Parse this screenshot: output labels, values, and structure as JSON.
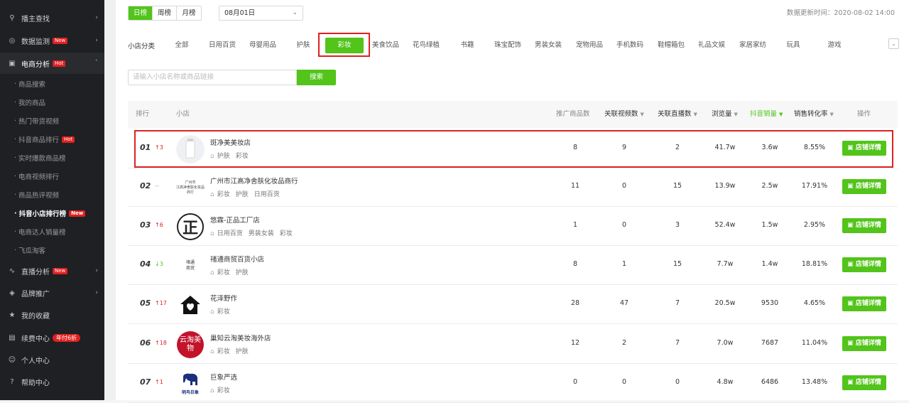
{
  "sidebar": {
    "items": [
      {
        "icon": "search-icon",
        "glyph": "⚲",
        "label": "播主查找",
        "arrow": "›"
      },
      {
        "icon": "monitor-icon",
        "glyph": "◎",
        "label": "数据监测",
        "badge": "New",
        "arrow": "›"
      },
      {
        "icon": "shop-icon",
        "glyph": "▣",
        "label": "电商分析",
        "badge": "Hot",
        "arrow": "ˆ"
      },
      {
        "icon": "live-icon",
        "glyph": "∿",
        "label": "直播分析",
        "badge": "New",
        "arrow": "›"
      },
      {
        "icon": "brand-icon",
        "glyph": "◈",
        "label": "品牌推广",
        "arrow": "›"
      },
      {
        "icon": "star-icon",
        "glyph": "★",
        "label": "我的收藏"
      },
      {
        "icon": "renew-icon",
        "glyph": "▤",
        "label": "续费中心",
        "badge": "年付6折"
      },
      {
        "icon": "user-icon",
        "glyph": "☺",
        "label": "个人中心"
      },
      {
        "icon": "help-icon",
        "glyph": "?",
        "label": "帮助中心"
      }
    ],
    "sub_items": [
      {
        "label": "商品搜索"
      },
      {
        "label": "我的商品"
      },
      {
        "label": "热门带货视频"
      },
      {
        "label": "抖音商品排行",
        "badge": "Hot"
      },
      {
        "label": "实时爆款商品榜"
      },
      {
        "label": "电商视频排行"
      },
      {
        "label": "商品热评视频"
      },
      {
        "label": "抖音小店排行榜",
        "badge": "New"
      },
      {
        "label": "电商达人销量榜"
      },
      {
        "label": "飞瓜淘客"
      }
    ]
  },
  "period_tabs": [
    "日榜",
    "周榜",
    "月榜"
  ],
  "date": {
    "value": "08月01日",
    "chevron": "⌄"
  },
  "updated": "数据更新时间：2020-08-02 14:00",
  "category": {
    "label": "小店分类",
    "items": [
      "全部",
      "日用百货",
      "母婴用品",
      "护肤",
      "彩妆",
      "美食饮品",
      "花鸟绿植",
      "书籍",
      "珠宝配饰",
      "男装女装",
      "宠物用品",
      "手机数码",
      "鞋帽箱包",
      "礼品文娱",
      "家居家纺",
      "玩具",
      "游戏"
    ],
    "more": "⌄"
  },
  "search": {
    "placeholder": "请输入小店名称或商品链接",
    "button": "搜索"
  },
  "table": {
    "headers": {
      "rank": "排行",
      "shop": "小店",
      "products": "推广商品数",
      "videos": "关联视频数",
      "lives": "关联直播数",
      "views": "浏览量",
      "sales": "抖音销量",
      "conv": "销售转化率",
      "action": "操作"
    },
    "tri": "▼",
    "tag_icon": "⌂",
    "detail_label": "店铺详情",
    "detail_icon": "▣",
    "rows": [
      {
        "rank": "01",
        "chg": "↑3",
        "dir": "up",
        "name": "斑净美美妆店",
        "tags": [
          "护肤",
          "彩妆"
        ],
        "products": "8",
        "videos": "9",
        "lives": "2",
        "views": "41.7w",
        "sales": "3.6w",
        "conv": "8.55%"
      },
      {
        "rank": "02",
        "chg": "--",
        "dir": "flat",
        "name": "广州市江高净舍肤化妆品商行",
        "logo_l1": "广州市",
        "logo_l2": "江高净舍肤化妆品商行",
        "tags": [
          "彩妆",
          "护肤",
          "日用百货"
        ],
        "products": "11",
        "videos": "0",
        "lives": "15",
        "views": "13.9w",
        "sales": "2.5w",
        "conv": "17.91%"
      },
      {
        "rank": "03",
        "chg": "↑6",
        "dir": "up",
        "name": "悠霖-正品工厂店",
        "logo_text": "正",
        "tags": [
          "日用百货",
          "男装女装",
          "彩妆"
        ],
        "products": "1",
        "videos": "0",
        "lives": "3",
        "views": "52.4w",
        "sales": "1.5w",
        "conv": "2.95%"
      },
      {
        "rank": "04",
        "chg": "↓3",
        "dir": "down",
        "name": "禇通商贸百货小店",
        "logo_l1": "禇通",
        "logo_l2": "商贸",
        "tags": [
          "彩妆",
          "护肤"
        ],
        "products": "8",
        "videos": "1",
        "lives": "15",
        "views": "7.7w",
        "sales": "1.4w",
        "conv": "18.81%"
      },
      {
        "rank": "05",
        "chg": "↑17",
        "dir": "up",
        "name": "花泽野作",
        "tags": [
          "彩妆"
        ],
        "products": "28",
        "videos": "47",
        "lives": "7",
        "views": "20.5w",
        "sales": "9530",
        "conv": "4.65%"
      },
      {
        "rank": "06",
        "chg": "↑18",
        "dir": "up",
        "name": "巢知云淘美妆海外店",
        "logo_text": "云淘美物",
        "tags": [
          "彩妆",
          "护肤"
        ],
        "products": "12",
        "videos": "2",
        "lives": "7",
        "views": "7.0w",
        "sales": "7687",
        "conv": "11.04%"
      },
      {
        "rank": "07",
        "chg": "↑1",
        "dir": "up",
        "name": "巨象严选",
        "logo_text": "明鸟巨象",
        "tags": [
          "彩妆"
        ],
        "products": "0",
        "videos": "0",
        "lives": "0",
        "views": "4.8w",
        "sales": "6486",
        "conv": "13.48%"
      }
    ]
  },
  "colors": {
    "accent": "#52c41a",
    "highlight": "#e02020",
    "sidebar_bg": "#1f2023"
  }
}
